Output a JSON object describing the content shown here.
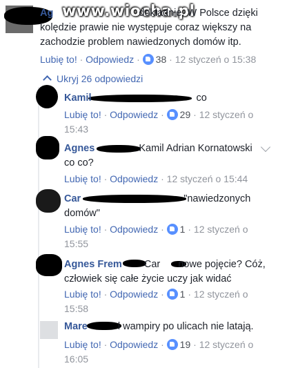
{
  "watermark": "www.wiocha.pl",
  "top_comment": {
    "name": "Ag",
    "text_line1": "dokładnie. W Polsce dzięki",
    "text_line2": "kolędzie prawie nie występuje coraz większy na",
    "text_line3": "zachodzie problem nawiedzonych domów itp.",
    "like": "Lubię to!",
    "reply": "Odpowiedz",
    "count": "38",
    "time": "12 styczeń o 15:38"
  },
  "hide_replies": "Ukryj 26 odpowiedzi",
  "separator": "·",
  "replies": [
    {
      "name": "Kamil",
      "text": "co",
      "like": "Lubię to!",
      "reply": "Odpowiedz",
      "count": "29",
      "time_a": "12 styczeń o",
      "time_b": "15:43"
    },
    {
      "name": "Agnes",
      "mention": "Kamil Adrian Kornatowski",
      "text2": "co co?",
      "like": "Lubię to!",
      "reply": "Odpowiedz",
      "time": "12 styczeń o 15:44"
    },
    {
      "name": "Car",
      "text": "\"nawiedzonych",
      "text2": "domów\"",
      "like": "Lubię to!",
      "reply": "Odpowiedz",
      "count": "1",
      "time_a": "12 styczeń o",
      "time_b": "15:55"
    },
    {
      "name": "Agnes Frem",
      "text": "Car",
      "text_b": "nowe pojęcie? Cóż,",
      "text2": "człowiek się całe życie uczy jak widać",
      "like": "Lubię to!",
      "reply": "Odpowiedz",
      "count": "1",
      "time_a": "12 styczeń o",
      "time_b": "15:58"
    },
    {
      "name": "Mare",
      "text": "l wampiry po ulicach nie latają.",
      "like": "Lubię to!",
      "reply": "Odpowiedz",
      "count": "19",
      "time_a": "12 styczeń o",
      "time_b": "16:05"
    }
  ]
}
